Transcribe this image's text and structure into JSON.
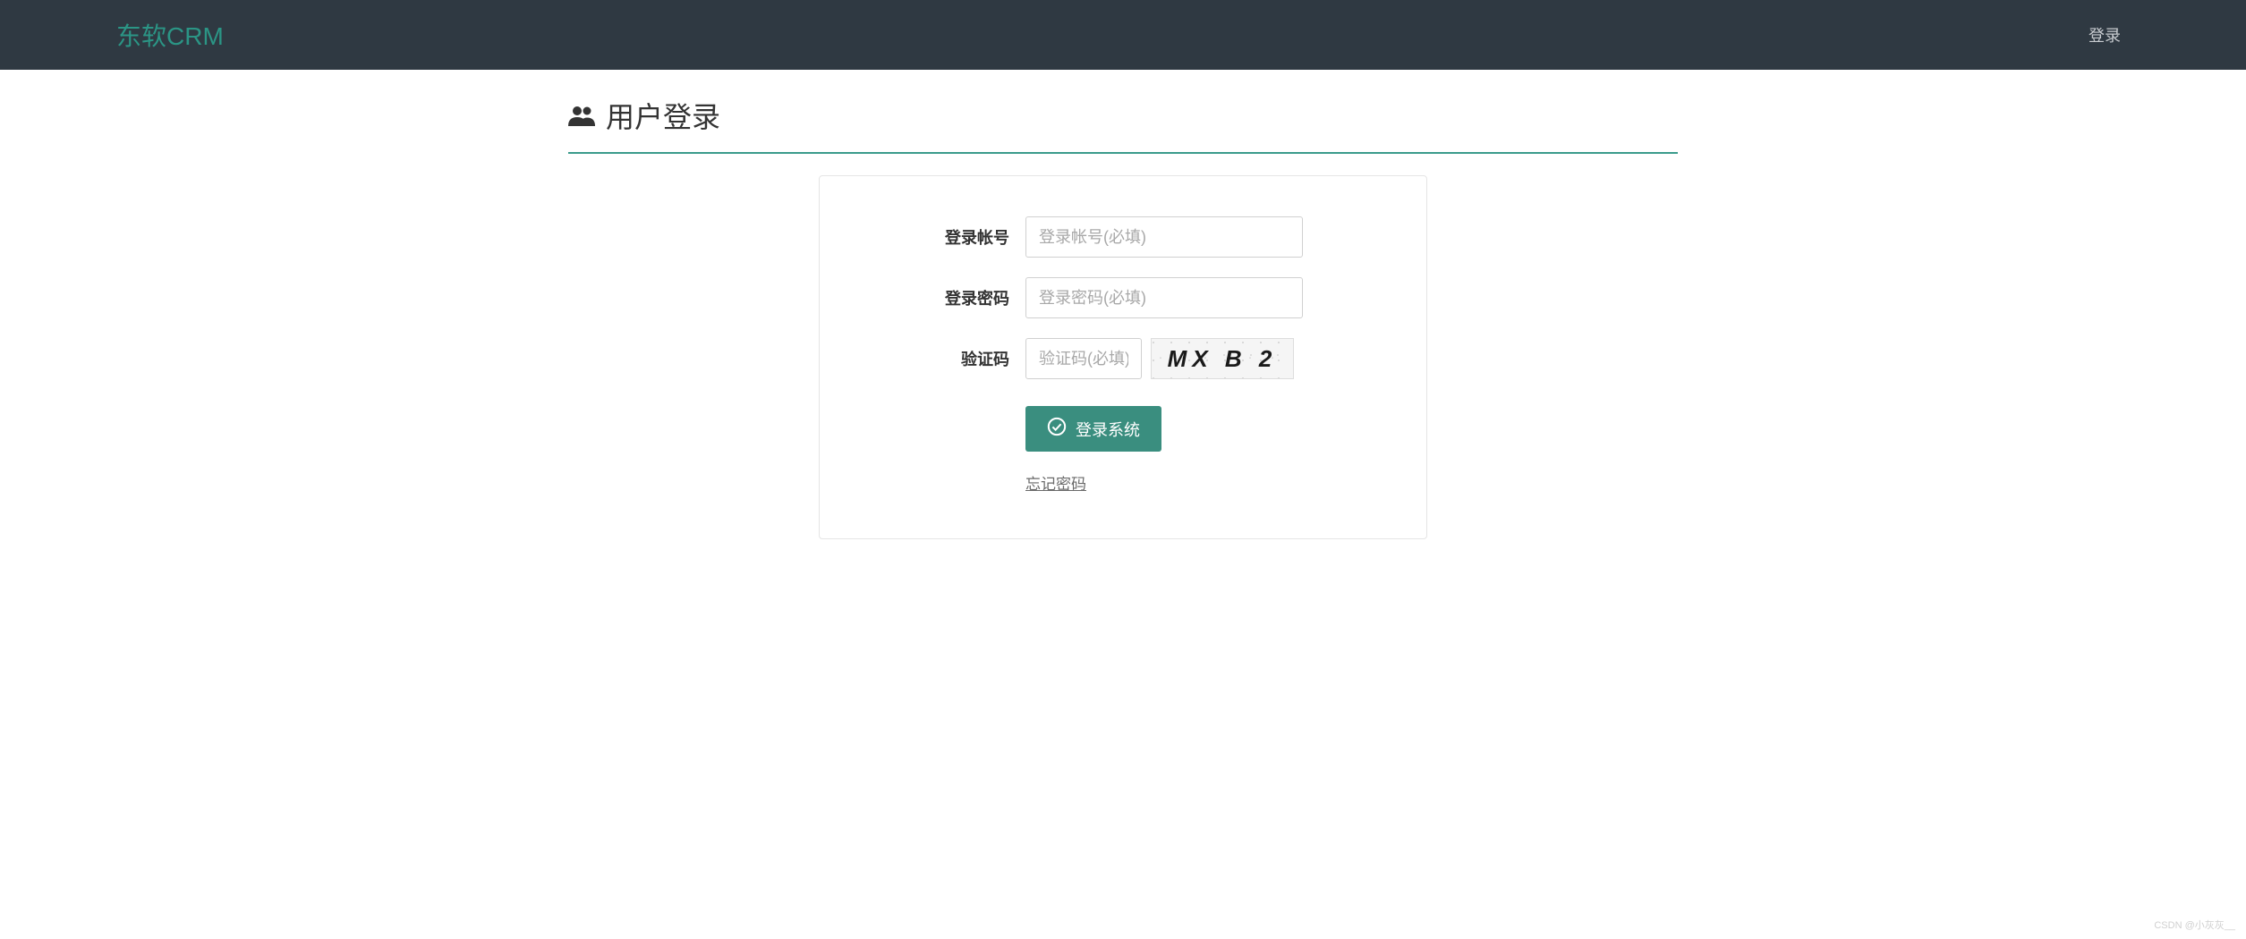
{
  "navbar": {
    "brand": "东软CRM",
    "login_link": "登录"
  },
  "header": {
    "title": "用户登录"
  },
  "form": {
    "account": {
      "label": "登录帐号",
      "placeholder": "登录帐号(必填)",
      "value": ""
    },
    "password": {
      "label": "登录密码",
      "placeholder": "登录密码(必填)",
      "value": ""
    },
    "captcha": {
      "label": "验证码",
      "placeholder": "验证码(必填)",
      "value": "",
      "image_text": "MX B 2"
    },
    "submit_label": "登录系统",
    "forgot_label": "忘记密码"
  },
  "watermark": "CSDN @小灰灰__"
}
